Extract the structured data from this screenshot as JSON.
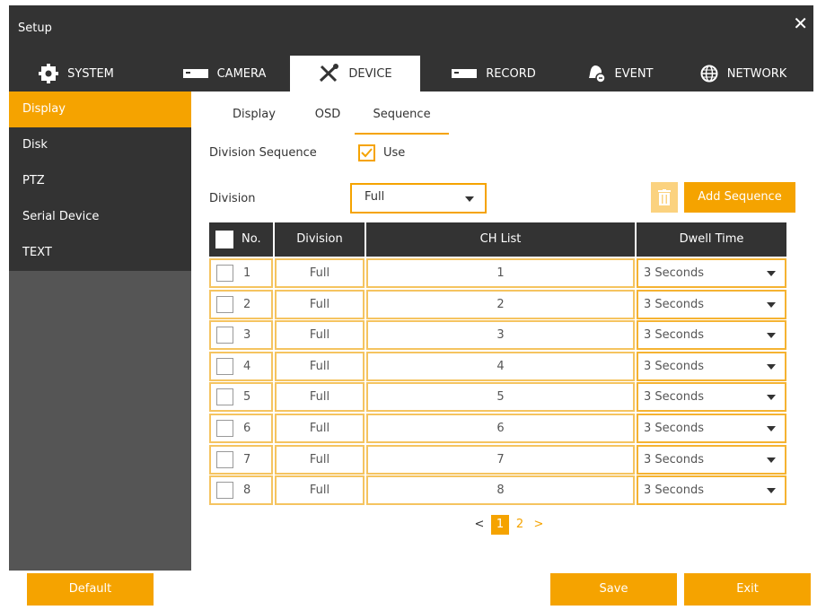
{
  "window": {
    "title": "Setup",
    "close_glyph": "✕"
  },
  "tabs": [
    {
      "label": "SYSTEM",
      "icon": "gear-icon"
    },
    {
      "label": "CAMERA",
      "icon": "camera-icon"
    },
    {
      "label": "DEVICE",
      "icon": "tools-icon",
      "active": true
    },
    {
      "label": "RECORD",
      "icon": "record-icon"
    },
    {
      "label": "EVENT",
      "icon": "bell-icon"
    },
    {
      "label": "NETWORK",
      "icon": "globe-icon"
    }
  ],
  "sidebar": {
    "items": [
      {
        "label": "Display",
        "active": true
      },
      {
        "label": "Disk"
      },
      {
        "label": "PTZ"
      },
      {
        "label": "Serial Device"
      },
      {
        "label": "TEXT"
      }
    ]
  },
  "subtabs": [
    {
      "label": "Display"
    },
    {
      "label": "OSD"
    },
    {
      "label": "Sequence",
      "active": true
    }
  ],
  "form": {
    "division_sequence_label": "Division Sequence",
    "use_label": "Use",
    "use_checked": true,
    "division_label": "Division",
    "division_value": "Full",
    "add_sequence_label": "Add Sequence"
  },
  "table": {
    "headers": {
      "no": "No.",
      "division": "Division",
      "ch_list": "CH List",
      "dwell": "Dwell Time"
    },
    "rows": [
      {
        "no": "1",
        "division": "Full",
        "ch": "1",
        "dwell": "3 Seconds"
      },
      {
        "no": "2",
        "division": "Full",
        "ch": "2",
        "dwell": "3 Seconds"
      },
      {
        "no": "3",
        "division": "Full",
        "ch": "3",
        "dwell": "3 Seconds"
      },
      {
        "no": "4",
        "division": "Full",
        "ch": "4",
        "dwell": "3 Seconds"
      },
      {
        "no": "5",
        "division": "Full",
        "ch": "5",
        "dwell": "3 Seconds"
      },
      {
        "no": "6",
        "division": "Full",
        "ch": "6",
        "dwell": "3 Seconds"
      },
      {
        "no": "7",
        "division": "Full",
        "ch": "7",
        "dwell": "3 Seconds"
      },
      {
        "no": "8",
        "division": "Full",
        "ch": "8",
        "dwell": "3 Seconds"
      }
    ]
  },
  "pager": {
    "prev": "<",
    "pages": [
      "1",
      "2"
    ],
    "current": "1",
    "next": ">"
  },
  "buttons": {
    "default": "Default",
    "save": "Save",
    "exit": "Exit"
  },
  "colors": {
    "accent": "#f5a300",
    "dark": "#333333",
    "sidebar_bg": "#555555"
  }
}
